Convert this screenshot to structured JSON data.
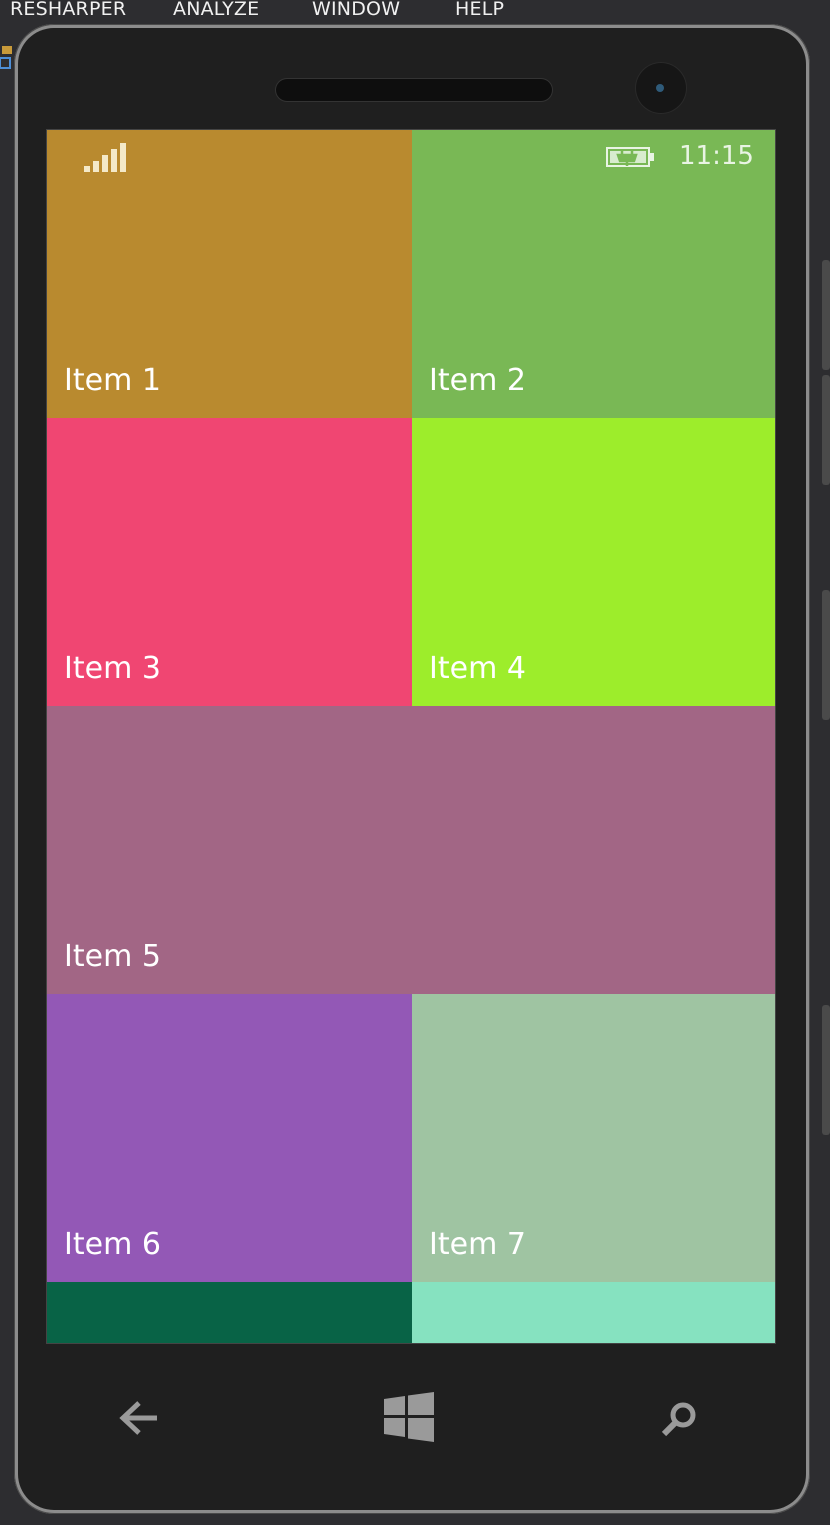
{
  "ide_menu": {
    "items": [
      "RESHARPER",
      "ANALYZE",
      "WINDOW",
      "HELP"
    ]
  },
  "status_bar": {
    "time": "11:15",
    "signal_icon": "signal-bars-icon",
    "battery_icon": "battery-charging-icon"
  },
  "tiles": [
    {
      "label": "Item 1",
      "color": "#b98a2f"
    },
    {
      "label": "Item 2",
      "color": "#79b855"
    },
    {
      "label": "Item 3",
      "color": "#f04672"
    },
    {
      "label": "Item 4",
      "color": "#9ded2b"
    },
    {
      "label": "Item 5",
      "color": "#a26685"
    },
    {
      "label": "Item 6",
      "color": "#9358b6"
    },
    {
      "label": "Item 7",
      "color": "#9fc4a2"
    },
    {
      "label": "",
      "color": "#086346"
    },
    {
      "label": "",
      "color": "#86e2c0"
    }
  ],
  "nav_buttons": {
    "back_icon": "back-arrow-icon",
    "start_icon": "windows-logo-icon",
    "search_icon": "search-icon"
  }
}
